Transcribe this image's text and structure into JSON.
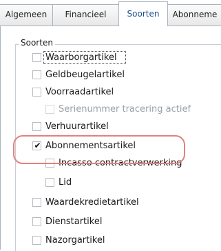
{
  "tabs": [
    {
      "label": "Algemeen"
    },
    {
      "label": "Financieel"
    },
    {
      "label": "Soorten"
    },
    {
      "label": "Abonneme"
    }
  ],
  "active_tab": "Soorten",
  "group": {
    "title": "Soorten",
    "items": [
      {
        "label": "Waarborgartikel",
        "checked": false,
        "enabled": true,
        "focused": true
      },
      {
        "label": "Geldbeugelartikel",
        "checked": false,
        "enabled": true
      },
      {
        "label": "Voorraadartikel",
        "checked": false,
        "enabled": true
      },
      {
        "label": "Serienummer tracering actief",
        "checked": false,
        "enabled": false
      },
      {
        "label": "Verhuurartikel",
        "checked": false,
        "enabled": true
      },
      {
        "label": "Abonnementsartikel",
        "checked": true,
        "enabled": true
      },
      {
        "label": "Incasso contractverwerking",
        "checked": false,
        "enabled": true
      },
      {
        "label": "Lid",
        "checked": false,
        "enabled": true
      },
      {
        "label": "Waardekredietartikel",
        "checked": false,
        "enabled": true
      },
      {
        "label": "Dienstartikel",
        "checked": false,
        "enabled": true
      },
      {
        "label": "Nazorgartikel",
        "checked": false,
        "enabled": true
      }
    ]
  },
  "annotation": {
    "color": "#e3807b"
  }
}
